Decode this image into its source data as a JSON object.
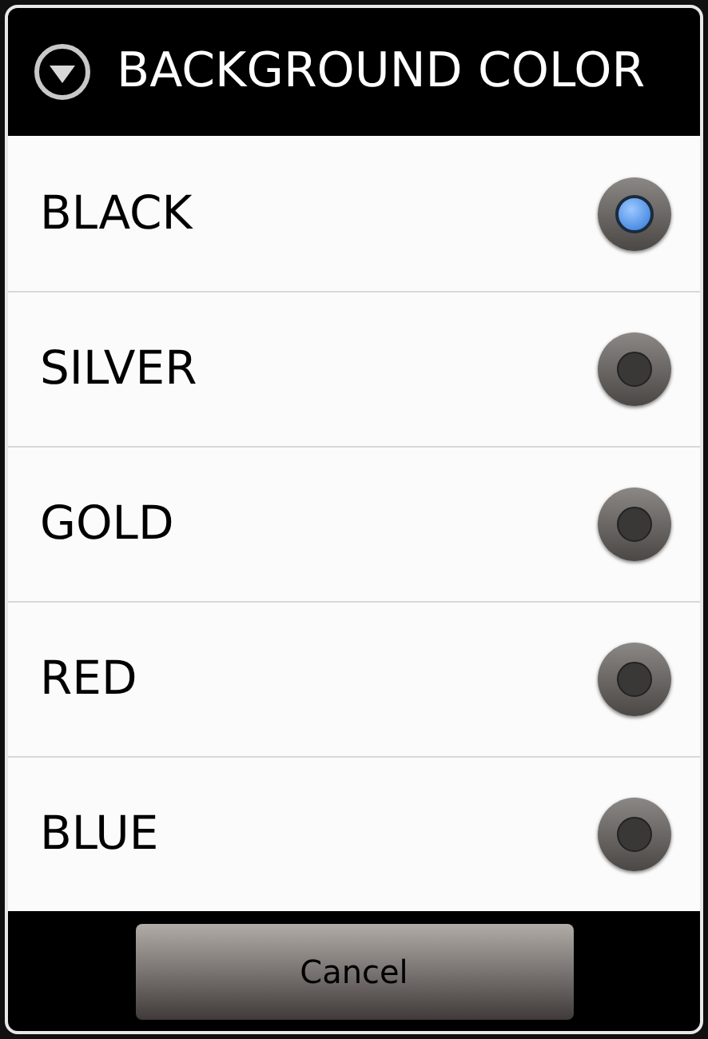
{
  "dialog": {
    "title": "BACKGROUND COLOR",
    "options": [
      {
        "label": "BLACK",
        "selected": true
      },
      {
        "label": "SILVER",
        "selected": false
      },
      {
        "label": "GOLD",
        "selected": false
      },
      {
        "label": "RED",
        "selected": false
      },
      {
        "label": "BLUE",
        "selected": false
      }
    ],
    "buttons": [
      "Cancel"
    ]
  }
}
